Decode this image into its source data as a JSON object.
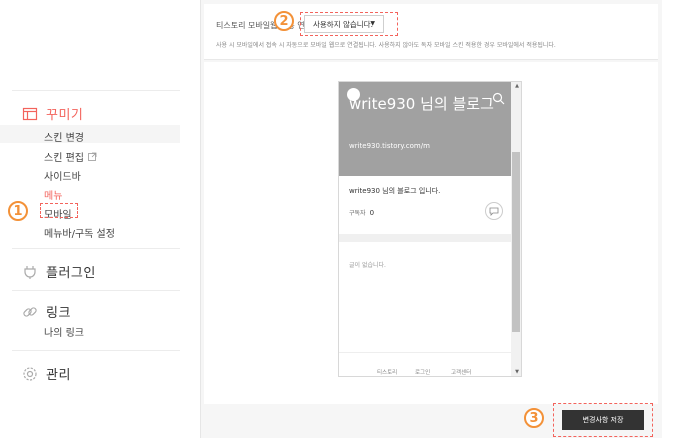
{
  "sidebar": {
    "decorate_title": "꾸미기",
    "decorate_items": [
      "스킨 변경",
      "스킨 편집",
      "사이드바",
      "메뉴",
      "모바일",
      "메뉴바/구독 설정"
    ],
    "plugin_title": "플러그인",
    "link_title": "링크",
    "link_items": [
      "나의 링크"
    ],
    "manage_title": "관리"
  },
  "settings": {
    "label": "티스토리 모바일웹 자동 연결",
    "select_value": "사용하지 않습니다.",
    "help_text": "사용 시 모바일에서 접속 시 자동으로 모바일 웹으로 연결됩니다. 사용하지 않아도 독자 모바일 스킨 적용한 경우 모바일에서 적용됩니다."
  },
  "preview": {
    "blog_title": "write930 님의 블로그",
    "blog_url": "write930.tistory.com/m",
    "intro_text": "write930 님의 블로그 입니다.",
    "subscribers_label": "구독자",
    "subscribers_count": "0",
    "empty_text": "글이 없습니다.",
    "footer_links": [
      "티스토리",
      "로그인",
      "고객센터"
    ]
  },
  "actions": {
    "save_label": "변경사항 저장"
  },
  "annotations": {
    "step1": "1",
    "step2": "2",
    "step3": "3"
  },
  "colors": {
    "accent_red": "#f3635c",
    "badge_orange": "#f39138",
    "save_button": "#333333"
  }
}
